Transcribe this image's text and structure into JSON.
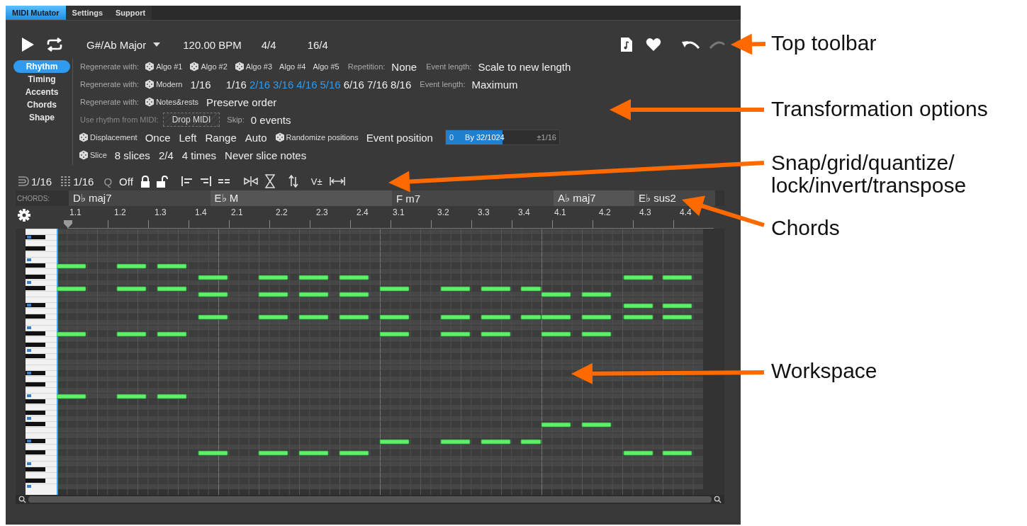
{
  "tabs": [
    {
      "label": "MIDI Mutator",
      "selected": true
    },
    {
      "label": "Settings",
      "selected": false
    },
    {
      "label": "Support",
      "selected": false
    }
  ],
  "toolbar": {
    "key": "G#/Ab Major",
    "tempo": "120.00 BPM",
    "time_signature": "4/4",
    "length": "16/4"
  },
  "modes": [
    {
      "label": "Rhythm",
      "selected": true
    },
    {
      "label": "Timing",
      "selected": false
    },
    {
      "label": "Accents",
      "selected": false
    },
    {
      "label": "Chords",
      "selected": false
    },
    {
      "label": "Shape",
      "selected": false
    }
  ],
  "option_rows": [
    [
      {
        "kind": "label",
        "text": "Regenerate with:"
      },
      {
        "kind": "dice",
        "text": "Algo #1"
      },
      {
        "kind": "dice",
        "text": "Algo #2"
      },
      {
        "kind": "dice",
        "text": "Algo #3"
      },
      {
        "kind": "option",
        "text": "Algo #4"
      },
      {
        "kind": "option",
        "text": "Algo #5"
      },
      {
        "kind": "label",
        "text": "Repetition:"
      },
      {
        "kind": "value",
        "text": "None"
      },
      {
        "kind": "label",
        "text": "Event length:"
      },
      {
        "kind": "value",
        "text": "Scale to new length"
      }
    ],
    [
      {
        "kind": "label",
        "text": "Regenerate with:"
      },
      {
        "kind": "dice",
        "text": "Modern"
      },
      {
        "kind": "value",
        "text": "1/16"
      },
      {
        "kind": "choices",
        "options": [
          {
            "text": "1/16",
            "selected": false
          },
          {
            "text": "2/16",
            "selected": true
          },
          {
            "text": "3/16",
            "selected": true
          },
          {
            "text": "4/16",
            "selected": true
          },
          {
            "text": "5/16",
            "selected": true
          },
          {
            "text": "6/16",
            "selected": false
          },
          {
            "text": "7/16",
            "selected": false
          },
          {
            "text": "8/16",
            "selected": false
          }
        ]
      },
      {
        "kind": "label",
        "text": "Event length:"
      },
      {
        "kind": "value",
        "text": "Maximum"
      }
    ],
    [
      {
        "kind": "label",
        "text": "Regenerate with:"
      },
      {
        "kind": "dice",
        "text": "Notes&rests"
      },
      {
        "kind": "value",
        "text": "Preserve order"
      }
    ],
    [
      {
        "kind": "dim",
        "text": "Use rhythm from MIDI:"
      },
      {
        "kind": "drop",
        "text": "Drop MIDI"
      },
      {
        "kind": "label",
        "text": "Skip:"
      },
      {
        "kind": "value",
        "text": "0 events"
      }
    ],
    [
      {
        "kind": "dice",
        "text": "Displacement"
      },
      {
        "kind": "value",
        "text": "Once"
      },
      {
        "kind": "value",
        "text": "Left"
      },
      {
        "kind": "value",
        "text": "Range"
      },
      {
        "kind": "value",
        "text": "Auto"
      },
      {
        "kind": "dice",
        "text": "Randomize positions"
      },
      {
        "kind": "value",
        "text": "Event position"
      },
      {
        "kind": "range",
        "min": "0",
        "text": "By 32/1024",
        "max": "±1/16",
        "level": 0.5
      }
    ],
    [
      {
        "kind": "dice",
        "text": "Slice"
      },
      {
        "kind": "value",
        "text": "8 slices"
      },
      {
        "kind": "value",
        "text": "2/4"
      },
      {
        "kind": "value",
        "text": "4 times"
      },
      {
        "kind": "value",
        "text": "Never slice notes"
      }
    ]
  ],
  "edit_toolbar": {
    "snap": "1/16",
    "grid": "1/16",
    "quantize_icon": "Q",
    "quantize": "Off",
    "velocity": "V±"
  },
  "chords": {
    "label": "CHORDS:",
    "items": [
      "D♭ maj7",
      "E♭ M",
      "F m7",
      "A♭ maj7",
      "E♭ sus2"
    ]
  },
  "ruler": [
    "1.1",
    "1.2",
    "1.3",
    "1.4",
    "2.1",
    "2.2",
    "2.3",
    "2.4",
    "3.1",
    "3.2",
    "3.3",
    "3.4",
    "4.1",
    "4.2",
    "4.3",
    "4.4"
  ],
  "annotations": [
    "Top toolbar",
    "Transformation options",
    "Snap/grid/quantize/ lock/invert/transpose",
    "Chords",
    "Workspace"
  ]
}
